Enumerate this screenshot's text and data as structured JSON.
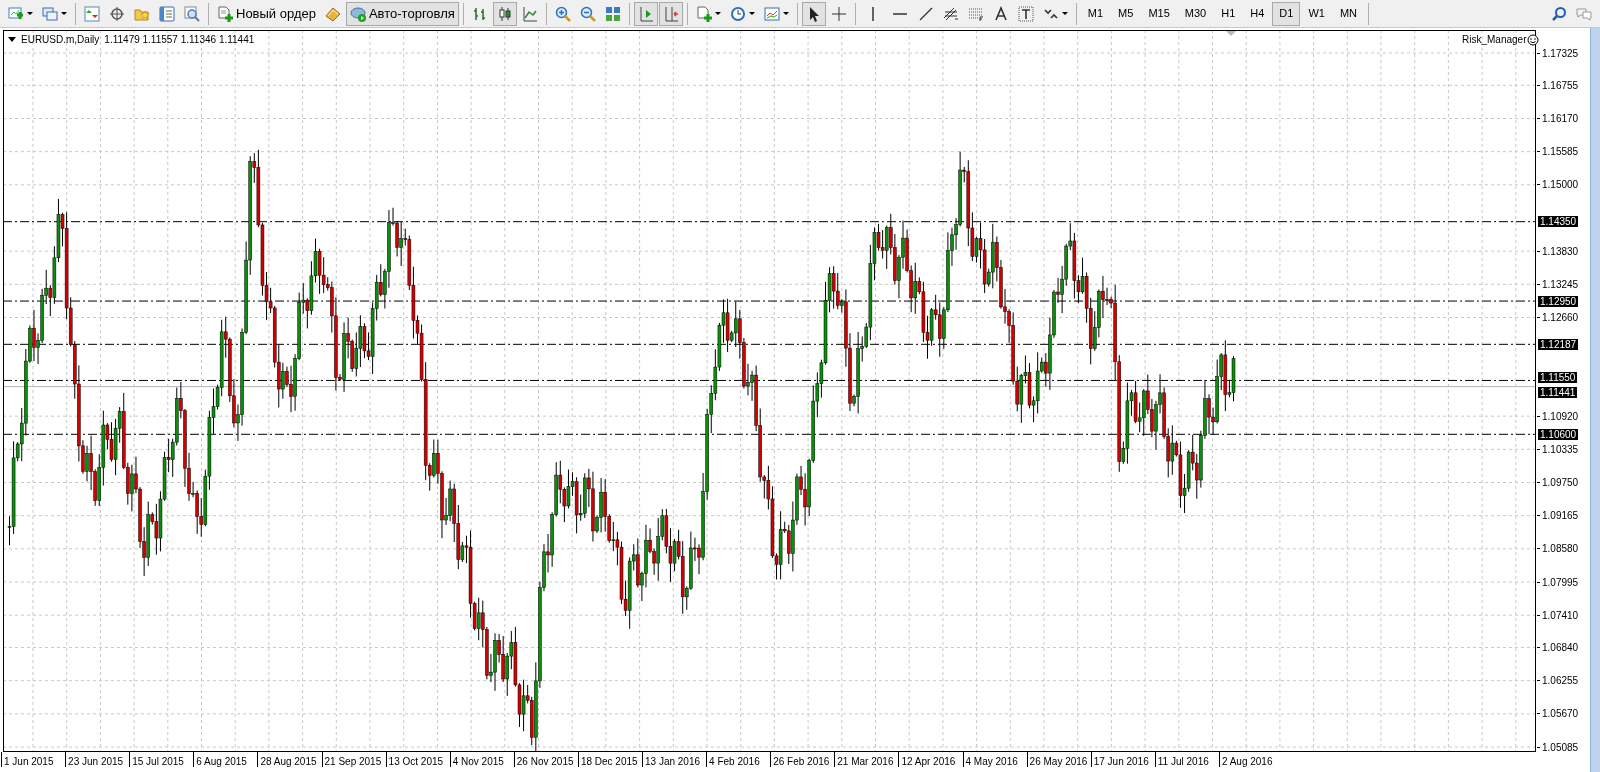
{
  "toolbar": {
    "new_order": {
      "label": "Новый ордер"
    },
    "auto_trading": {
      "label": "Авто-торговля",
      "on": true
    },
    "chart_types": [
      {
        "selected": false
      },
      {
        "selected": true
      },
      {
        "selected": false
      }
    ],
    "chart_shift": {
      "on": true
    },
    "auto_scroll": {
      "on": true
    },
    "cursor_tools": [
      {
        "selected": true
      },
      {
        "selected": false
      }
    ],
    "timeframes": [
      {
        "label": "M1",
        "selected": false
      },
      {
        "label": "M5",
        "selected": false
      },
      {
        "label": "M15",
        "selected": false
      },
      {
        "label": "M30",
        "selected": false
      },
      {
        "label": "H1",
        "selected": false
      },
      {
        "label": "H4",
        "selected": false
      },
      {
        "label": "D1",
        "selected": true
      },
      {
        "label": "W1",
        "selected": false
      },
      {
        "label": "MN",
        "selected": false
      }
    ]
  },
  "chart": {
    "symbol": "EURUSD.m,Daily",
    "ohlc": "1.11479 1.11557 1.11346 1.11441",
    "expert": "Risk_Manager",
    "price_ticks": [
      "1.17325",
      "1.16755",
      "1.16170",
      "1.15585",
      "1.15000",
      "1.13830",
      "1.13245",
      "1.12660",
      "1.10920",
      "1.10335",
      "1.09750",
      "1.09165",
      "1.08580",
      "1.07995",
      "1.07410",
      "1.06840",
      "1.06255",
      "1.05670",
      "1.05085"
    ],
    "level_lines": [
      {
        "label": "1.14350"
      },
      {
        "label": "1.12950"
      },
      {
        "label": "1.12187"
      },
      {
        "label": "1.11550"
      },
      {
        "label": "1.10600"
      }
    ],
    "bid": "1.11441",
    "dates": [
      "1 Jun 2015",
      "23 Jun 2015",
      "15 Jul 2015",
      "6 Aug 2015",
      "28 Aug 2015",
      "21 Sep 2015",
      "13 Oct 2015",
      "4 Nov 2015",
      "26 Nov 2015",
      "18 Dec 2015",
      "13 Jan 2016",
      "4 Feb 2016",
      "26 Feb 2016",
      "21 Mar 2016",
      "12 Apr 2016",
      "4 May 2016",
      "26 May 2016",
      "17 Jun 2016",
      "11 Jul 2016",
      "2 Aug 2016"
    ]
  }
}
